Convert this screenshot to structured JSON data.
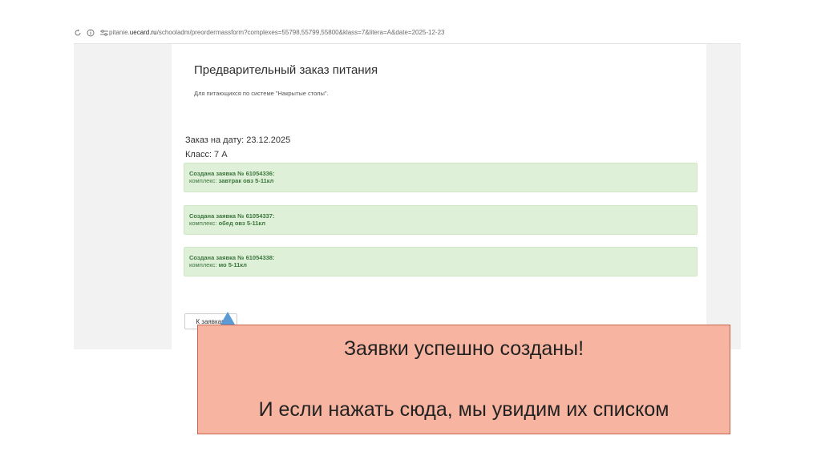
{
  "browser": {
    "url_prefix": "pitanie.",
    "url_domain": "uecard.ru",
    "url_path": "/schooladm/preordermassform?complexes=55798,55799,55800&klass=7&litera=A&date=2025-12-23"
  },
  "page": {
    "title": "Предварительный заказ питания",
    "subtitle": "Для питающихся по системе \"Накрытые столы\".",
    "order_date": "Заказ на дату: 23.12.2025",
    "order_class": "Класс: 7 А"
  },
  "alerts": [
    {
      "head": "Создана заявка № 61054336:",
      "label": "комплекс: ",
      "value": "завтрак овз 5-11кл"
    },
    {
      "head": "Создана заявка № 61054337:",
      "label": "комплекс: ",
      "value": "обед овз 5-11кл"
    },
    {
      "head": "Создана заявка № 61054338:",
      "label": "комплекс: ",
      "value": "мо 5-11кл"
    }
  ],
  "button": {
    "to_requests": "К заявкам"
  },
  "callout": {
    "line1": "Заявки успешно созданы!",
    "line2": "И если нажать сюда, мы увидим их списком"
  },
  "colors": {
    "alert_bg": "#dff0d8",
    "alert_text": "#3c763d",
    "callout_bg": "#f7b4a0",
    "arrow": "#5b9bd5"
  }
}
